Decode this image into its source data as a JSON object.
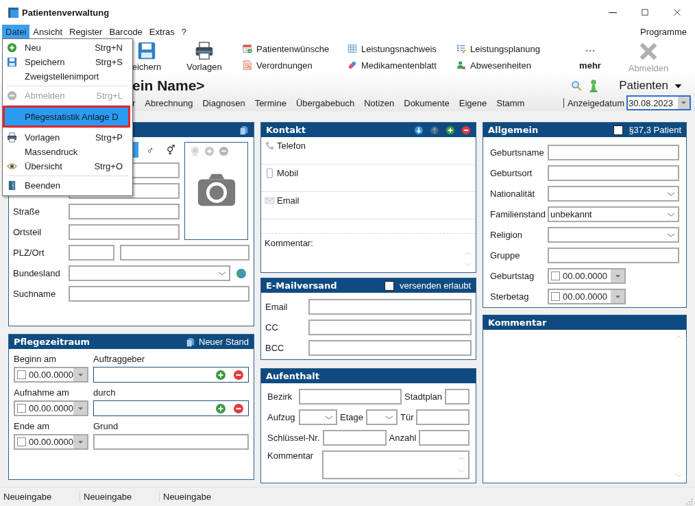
{
  "window": {
    "title": "Patientenverwaltung",
    "controls": [
      {
        "kind": "minimize"
      },
      {
        "kind": "maximize"
      },
      {
        "kind": "close"
      }
    ]
  },
  "menu_bar": {
    "items": [
      {
        "label": "Datei",
        "selected": true
      },
      {
        "label": "Ansicht",
        "selected": false
      },
      {
        "label": "Register",
        "selected": false
      },
      {
        "label": "Barcode",
        "selected": false
      },
      {
        "label": "Extras",
        "selected": false
      },
      {
        "label": "?",
        "selected": false
      }
    ],
    "right_label": "Programme"
  },
  "toolbar": {
    "large_buttons": [
      {
        "label": "eichern"
      },
      {
        "label": "Vorlagen"
      }
    ],
    "links": [
      {
        "label": "Patientenwünsche"
      },
      {
        "label": "Verordnungen"
      },
      {
        "label": "Leistungsnachweis"
      },
      {
        "label": "Medikamentenblatt"
      },
      {
        "label": "Leistungsplanung"
      },
      {
        "label": "Abwesenheiten"
      }
    ],
    "more": {
      "label": "mehr"
    },
    "logout": {
      "label": "Abmelden",
      "disabled": true
    }
  },
  "patient_header": {
    "name": "ein Name>",
    "module": "Patienten"
  },
  "tabs": [
    {
      "label": "r",
      "selected": false
    },
    {
      "label": "Abrechnung",
      "selected": false
    },
    {
      "label": "Diagnosen",
      "selected": false
    },
    {
      "label": "Termine",
      "selected": false
    },
    {
      "label": "Übergabebuch",
      "selected": false
    },
    {
      "label": "Notizen",
      "selected": false
    },
    {
      "label": "Dokumente",
      "selected": false
    },
    {
      "label": "Eigene",
      "selected": false
    },
    {
      "label": "Stamm",
      "selected": false
    }
  ],
  "display_date": {
    "label": "Anzeigedatum",
    "value": "30.08.2023"
  },
  "personal_panel": {
    "gender_buttons": [
      {
        "selected": true
      },
      {
        "symbol": "♂",
        "selected": false
      },
      {
        "symbol": "⚥",
        "selected": false
      }
    ],
    "photo_actions": [
      {
        "disabled": true
      },
      {
        "disabled": true
      },
      {
        "disabled": true
      }
    ],
    "rows": [
      {
        "kind": "text"
      },
      {
        "kind": "text"
      },
      {
        "label": "Straße",
        "kind": "text"
      },
      {
        "label": "Ortsteil",
        "kind": "text"
      },
      {
        "label": "PLZ/Ort",
        "kind": "zip"
      },
      {
        "label": "Bundesland",
        "kind": "select"
      },
      {
        "label": "Suchname",
        "kind": "text"
      }
    ]
  },
  "care_panel": {
    "title": "Pflegezeitraum",
    "action": "Neuer Stand",
    "groups": [
      {
        "date_label": "Beginn am",
        "date": {
          "checked": false,
          "value": "00.00.0000"
        },
        "label": "Auftraggeber",
        "kind": "lookup"
      },
      {
        "date_label": "Aufnahme am",
        "date": {
          "checked": false,
          "value": "00.00.0000"
        },
        "label": "durch",
        "kind": "lookup"
      },
      {
        "date_label": "Ende am",
        "date": {
          "checked": false,
          "value": "00.00.0000"
        },
        "label": "Grund",
        "kind": "text"
      }
    ]
  },
  "contact_panel": {
    "title": "Kontakt",
    "actions": [
      {
        "disabled": false
      },
      {
        "disabled": true
      },
      {
        "disabled": false
      },
      {
        "disabled": false
      }
    ],
    "entries": [
      {
        "label": "Telefon"
      },
      {
        "label": "Mobil"
      },
      {
        "label": "Email"
      }
    ],
    "comment_label": "Kommentar:"
  },
  "email_panel": {
    "title": "E-Mailversand",
    "consent": {
      "label": "versenden erlaubt",
      "checked": false
    },
    "fields": [
      {
        "label": "Email"
      },
      {
        "label": "CC"
      },
      {
        "label": "BCC"
      }
    ]
  },
  "stay_panel": {
    "title": "Aufenthalt",
    "rows": [
      [
        {
          "label": "Bezirk",
          "kind": "wide"
        },
        {
          "label": "Stadtplan",
          "kind": "tiny"
        }
      ],
      [
        {
          "label": "Aufzug",
          "kind": "select"
        },
        {
          "label": "Etage",
          "kind": "select-small"
        },
        {
          "label": "Tür",
          "kind": "short"
        }
      ],
      [
        {
          "label": "Schlüssel-Nr.",
          "kind": "medium"
        },
        {
          "label": "Anzahl",
          "kind": "short"
        }
      ],
      [
        {
          "label": "Kommentar",
          "kind": "memo"
        }
      ]
    ]
  },
  "general_panel": {
    "title": "Allgemein",
    "flag": {
      "label": "§37,3 Patient",
      "checked": false
    },
    "rows": [
      {
        "label": "Geburtsname",
        "kind": "text"
      },
      {
        "label": "Geburtsort",
        "kind": "text"
      },
      {
        "label": "Nationalität",
        "kind": "select"
      },
      {
        "label": "Familienstand",
        "kind": "select",
        "value": "unbekannt"
      },
      {
        "label": "Religion",
        "kind": "select"
      },
      {
        "label": "Gruppe",
        "kind": "text"
      },
      {
        "label": "Geburtstag",
        "kind": "date",
        "date": {
          "checked": false,
          "value": "00.00.0000"
        }
      },
      {
        "label": "Sterbetag",
        "kind": "date",
        "date": {
          "checked": false,
          "value": "00.00.0000"
        }
      }
    ]
  },
  "comment_panel": {
    "title": "Kommentar"
  },
  "status_bar": [
    "Neueingabe",
    "Neueingabe",
    "Neueingabe"
  ],
  "file_menu": {
    "items": [
      {
        "kind": "item",
        "label": "Neu",
        "shortcut": "Strg+N",
        "disabled": false,
        "selected": false,
        "marked": false
      },
      {
        "kind": "item",
        "label": "Speichern",
        "shortcut": "Strg+S",
        "disabled": false,
        "selected": false,
        "marked": false
      },
      {
        "kind": "item",
        "label": "Zweigstellenimport",
        "disabled": false,
        "selected": false,
        "marked": false
      },
      {
        "kind": "separator"
      },
      {
        "kind": "item",
        "label": "Abmelden",
        "shortcut": "Strg+L",
        "disabled": true,
        "selected": false,
        "marked": false
      },
      {
        "kind": "separator"
      },
      {
        "kind": "item",
        "label": "Pflegestatistik Anlage D",
        "disabled": false,
        "selected": true,
        "marked": true
      },
      {
        "kind": "separator"
      },
      {
        "kind": "item",
        "label": "Vorlagen",
        "shortcut": "Strg+P",
        "disabled": false,
        "selected": false,
        "marked": false
      },
      {
        "kind": "item",
        "label": "Massendruck",
        "disabled": false,
        "selected": false,
        "marked": false
      },
      {
        "kind": "item",
        "label": "Übersicht",
        "shortcut": "Strg+O",
        "disabled": false,
        "selected": false,
        "marked": false
      },
      {
        "kind": "separator"
      },
      {
        "kind": "item",
        "label": "Beenden",
        "disabled": false,
        "selected": false,
        "marked": false
      }
    ]
  }
}
